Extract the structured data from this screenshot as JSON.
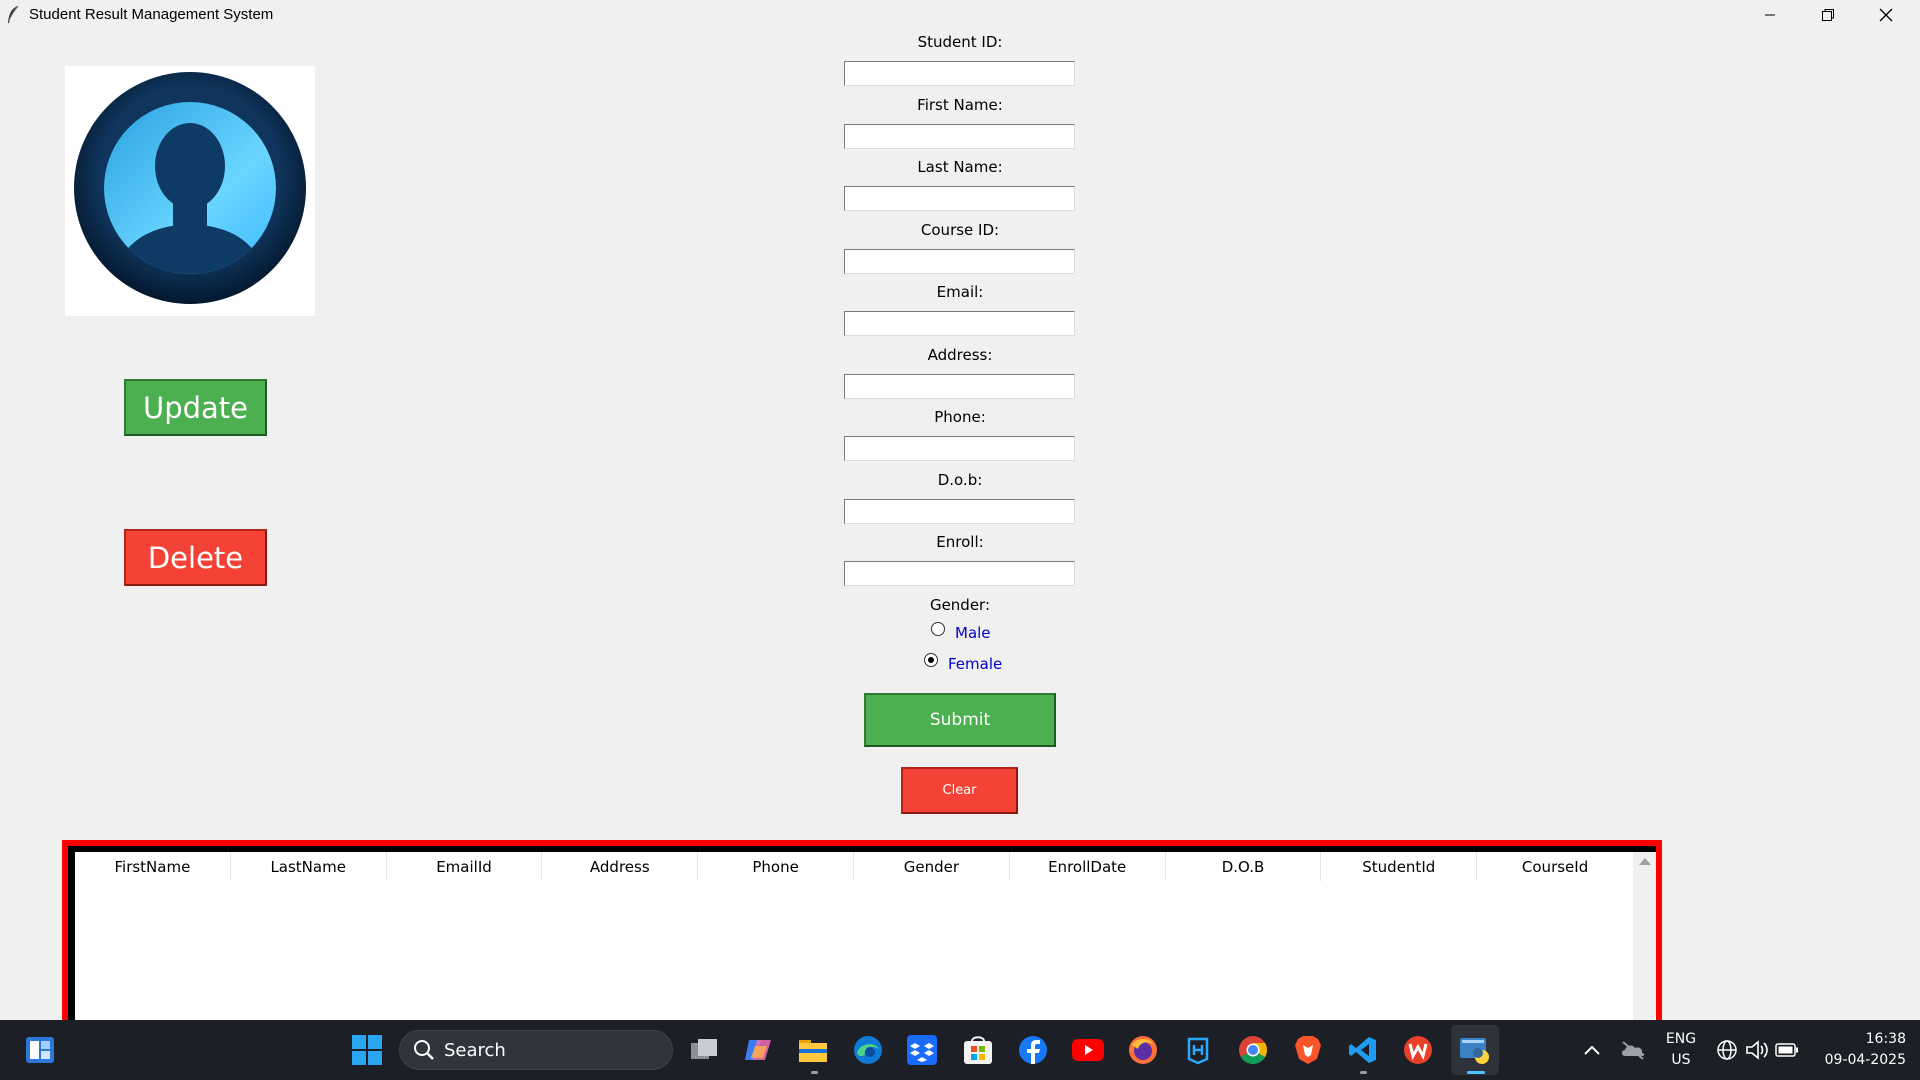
{
  "window": {
    "title": "Student Result Management System",
    "minimize_icon": "minimize-icon",
    "restore_icon": "restore-icon",
    "close_icon": "close-icon"
  },
  "avatar": {
    "icon": "user-avatar-icon"
  },
  "actions": {
    "update_label": "Update",
    "delete_label": "Delete"
  },
  "form": {
    "fields": [
      {
        "label": "Student ID:",
        "value": ""
      },
      {
        "label": "First Name:",
        "value": ""
      },
      {
        "label": "Last Name:",
        "value": ""
      },
      {
        "label": "Course ID:",
        "value": ""
      },
      {
        "label": "Email:",
        "value": ""
      },
      {
        "label": "Address:",
        "value": ""
      },
      {
        "label": "Phone:",
        "value": ""
      },
      {
        "label": "D.o.b:",
        "value": ""
      },
      {
        "label": "Enroll:",
        "value": ""
      }
    ],
    "gender_label": "Gender:",
    "gender_options": [
      {
        "label": "Male",
        "selected": false
      },
      {
        "label": "Female",
        "selected": true
      }
    ],
    "submit_label": "Submit",
    "clear_label": "Clear"
  },
  "table": {
    "columns": [
      "FirstName",
      "LastName",
      "EmailId",
      "Address",
      "Phone",
      "Gender",
      "EnrollDate",
      "D.O.B",
      "StudentId",
      "CourseId"
    ],
    "rows": []
  },
  "taskbar": {
    "search_placeholder": "Search",
    "apps": [
      "widgets-icon",
      "start-icon",
      "task-view-icon",
      "copilot-icon",
      "file-explorer-icon",
      "edge-icon",
      "dropbox-icon",
      "microsoft-store-icon",
      "facebook-icon",
      "youtube-icon",
      "firefox-icon",
      "app-icon",
      "chrome-icon",
      "brave-icon",
      "vscode-icon",
      "wps-office-icon",
      "python-icon"
    ],
    "tray": {
      "language": "ENG",
      "region": "US",
      "time": "16:38",
      "date": "09-04-2025"
    }
  },
  "colors": {
    "green": "#4caf50",
    "red": "#f44336",
    "frame_red": "#ff0000",
    "radio_text": "#0000cc"
  }
}
